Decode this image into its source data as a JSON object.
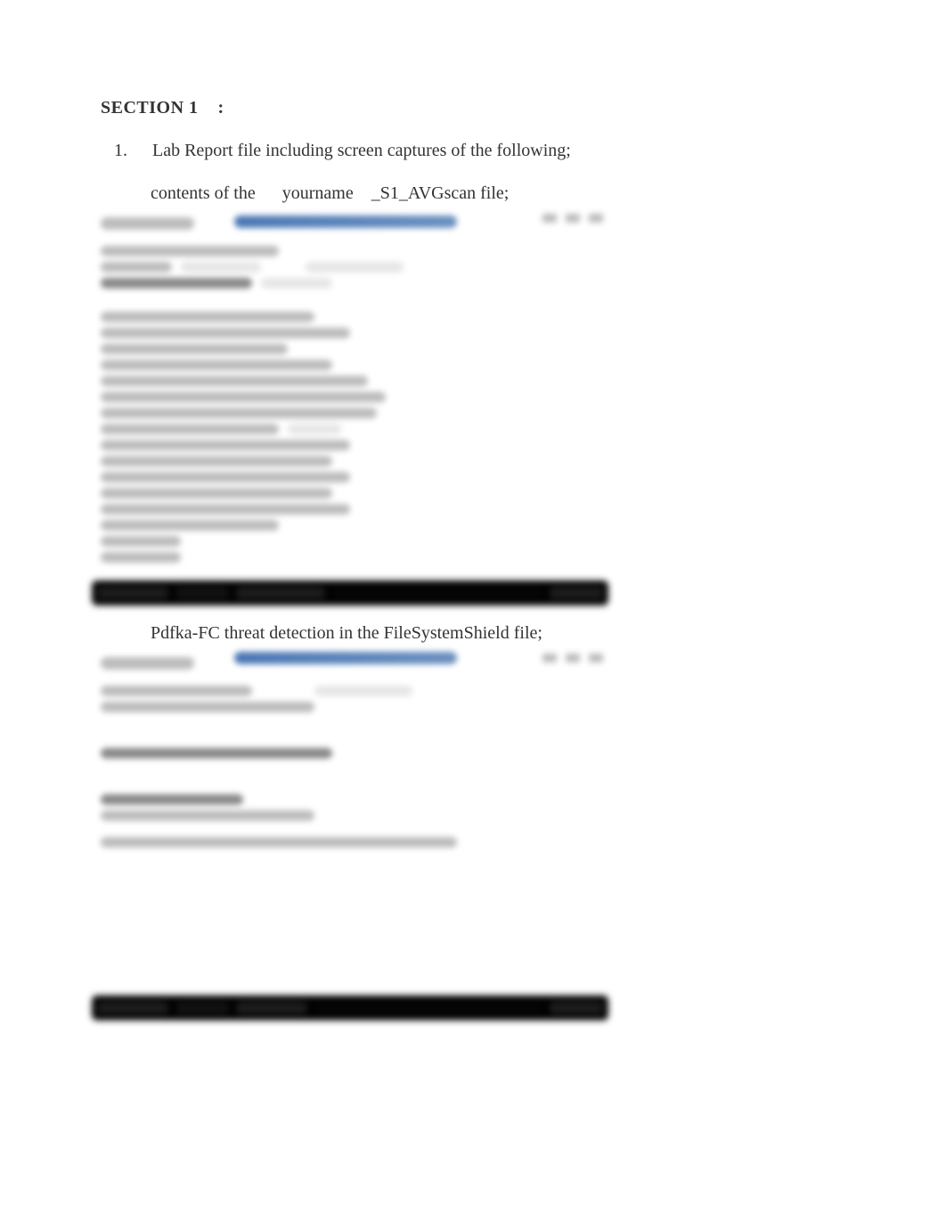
{
  "section": {
    "heading": "SECTION 1    :"
  },
  "list": {
    "item_num": "1.",
    "item_text": "Lab Report file including screen captures of the following;"
  },
  "bullets": {
    "icon": "",
    "item1_prefix": "contents of the ",
    "item1_emph": "yourname",
    "item1_suffix": "_S1_AVGscan file;",
    "item2": "Pdfka-FC threat detection in the FileSystemShield file;"
  }
}
